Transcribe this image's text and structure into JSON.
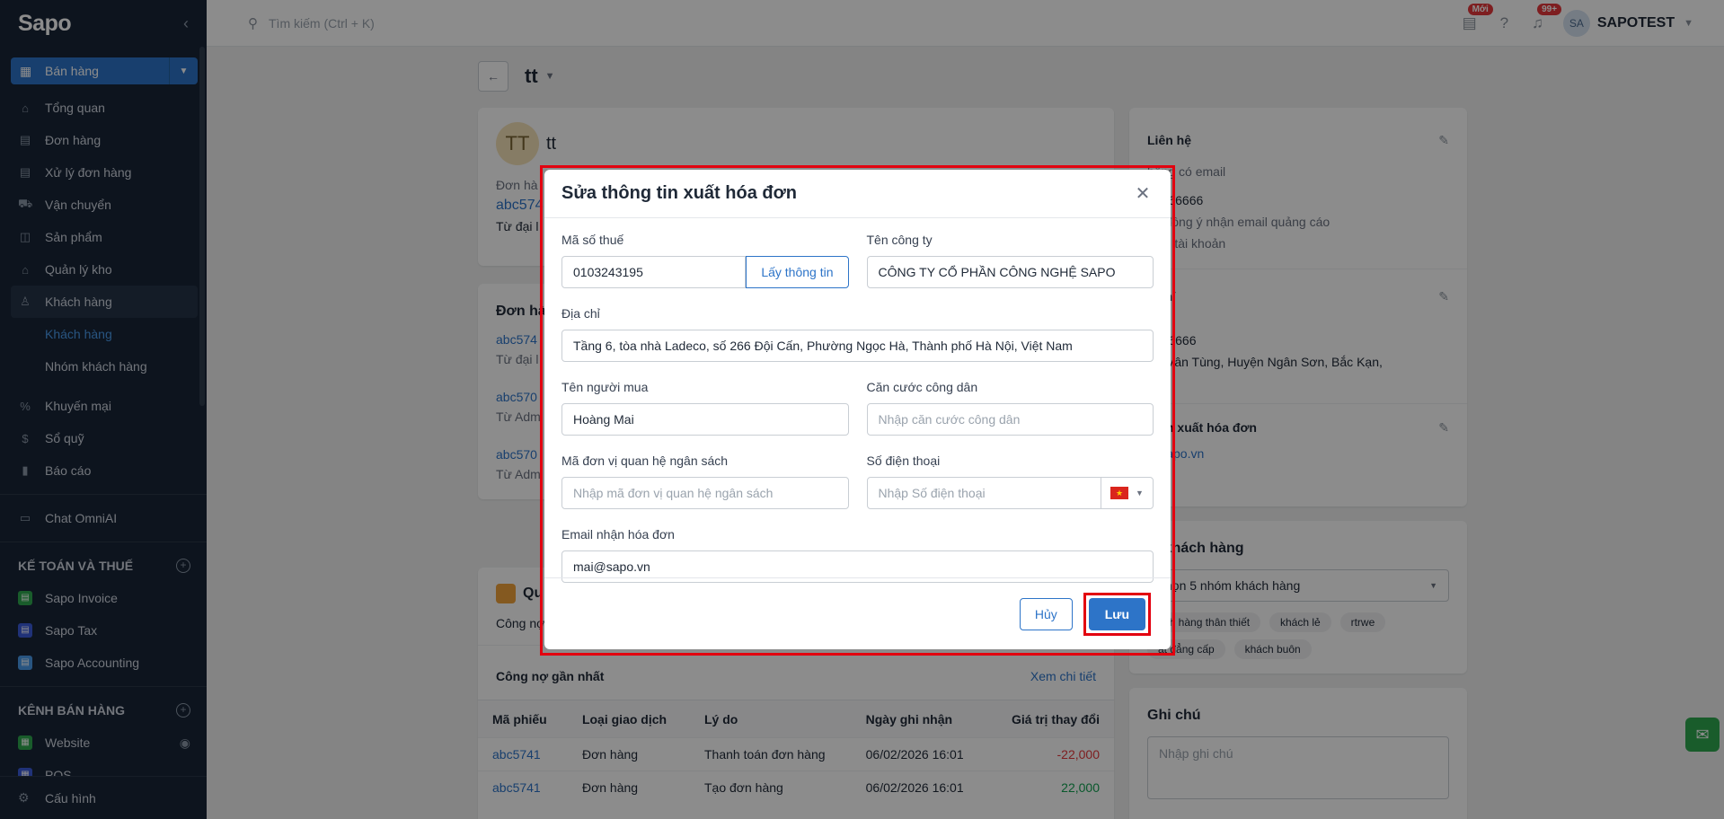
{
  "sidebar": {
    "logo": "Sapo",
    "sales_button": "Bán hàng",
    "items": [
      {
        "label": "Tổng quan",
        "icon": "home-icon"
      },
      {
        "label": "Đơn hàng",
        "icon": "order-icon"
      },
      {
        "label": "Xử lý đơn hàng",
        "icon": "order-process-icon"
      },
      {
        "label": "Vận chuyển",
        "icon": "truck-icon"
      },
      {
        "label": "Sản phẩm",
        "icon": "box-icon"
      },
      {
        "label": "Quản lý kho",
        "icon": "warehouse-icon"
      },
      {
        "label": "Khách hàng",
        "icon": "user-icon"
      }
    ],
    "sub_items": [
      "Khách hàng",
      "Nhóm khách hàng"
    ],
    "items2": [
      {
        "label": "Khuyến mại",
        "icon": "promo-icon"
      },
      {
        "label": "Sổ quỹ",
        "icon": "cashbook-icon"
      },
      {
        "label": "Báo cáo",
        "icon": "report-icon"
      }
    ],
    "chat": "Chat OmniAI",
    "section_accounting": "KẾ TOÁN VÀ THUẾ",
    "apps": [
      "Sapo Invoice",
      "Sapo Tax",
      "Sapo Accounting"
    ],
    "section_channels": "KÊNH BÁN HÀNG",
    "channels": [
      "Website",
      "POS"
    ],
    "config": "Cấu hình"
  },
  "topbar": {
    "search_placeholder": "Tìm kiếm (Ctrl + K)",
    "badge_new": "Mới",
    "badge_count": "99+",
    "avatar": "SA",
    "store": "SAPOTEST"
  },
  "page": {
    "title": "tt",
    "customer": {
      "avatar": "TT",
      "name": "tt",
      "order_label": "Đơn hà",
      "order_code": "abc574",
      "source": "Từ đại l"
    },
    "orders": {
      "title": "Đơn hà",
      "rows": [
        {
          "code": "abc574",
          "source": "Từ đại l"
        },
        {
          "code": "abc570",
          "source": "Từ Adm"
        },
        {
          "code": "abc570",
          "source": "Từ Adm"
        }
      ]
    },
    "debt": {
      "title": "Qu",
      "sub": "Công nợ",
      "recent_label": "Công nợ gần nhất",
      "view_detail": "Xem chi tiết",
      "headers": [
        "Mã phiếu",
        "Loại giao dịch",
        "Lý do",
        "Ngày ghi nhận",
        "Giá trị thay đổi"
      ],
      "rows": [
        [
          "abc5741",
          "Đơn hàng",
          "Thanh toán đơn hàng",
          "06/02/2026 16:01",
          "-22,000"
        ],
        [
          "abc5741",
          "Đơn hàng",
          "Tạo đơn hàng",
          "06/02/2026 16:01",
          "22,000"
        ]
      ]
    },
    "contact": {
      "title": "Liên hệ",
      "email": "hông có email",
      "phone": "36666666",
      "consent": "ng đồng ý nhận email quảng cáo",
      "account": "a có tài khoản"
    },
    "address": {
      "title": "a chỉ",
      "phone": "6666666",
      "line1": "Xã Vân Tùng, Huyện Ngân Sơn, Bắc Kạn,",
      "line2": "am"
    },
    "invoice": {
      "title": "g tin xuất hóa đơn",
      "email": "@sapo.vn"
    },
    "groups": {
      "title": "m khách hàng",
      "select": "chọn 5 nhóm khách hàng",
      "tags": [
        "ách hàng thân thiết",
        "khách lẻ",
        "rtrwe",
        "ất đẳng cấp",
        "khách buôn"
      ]
    },
    "notes": {
      "title": "Ghi chú",
      "placeholder": "Nhập ghi chú"
    }
  },
  "modal": {
    "title": "Sửa thông tin xuất hóa đơn",
    "tax_label": "Mã số thuế",
    "tax_value": "0103243195",
    "fetch_button": "Lấy thông tin",
    "company_label": "Tên công ty",
    "company_value": "CÔNG TY CỔ PHẦN CÔNG NGHỆ SAPO",
    "address_label": "Địa chỉ",
    "address_value": "Tầng 6, tòa nhà Ladeco, số 266 Đội Cấn, Phường Ngọc Hà, Thành phố Hà Nội, Việt Nam",
    "buyer_label": "Tên người mua",
    "buyer_value": "Hoàng Mai",
    "id_label": "Căn cước công dân",
    "id_placeholder": "Nhập căn cước công dân",
    "budget_label": "Mã đơn vị quan hệ ngân sách",
    "budget_placeholder": "Nhập mã đơn vị quan hệ ngân sách",
    "phone_label": "Số điện thoại",
    "phone_placeholder": "Nhập Số điện thoại",
    "email_label": "Email nhận hóa đơn",
    "email_value": "mai@sapo.vn",
    "cancel": "Hủy",
    "save": "Lưu"
  },
  "colors": {
    "sidebar_bg": "#182537",
    "primary": "#2d74c8",
    "highlight": "#e3000f",
    "negative": "#e5383b",
    "positive": "#12a150"
  }
}
